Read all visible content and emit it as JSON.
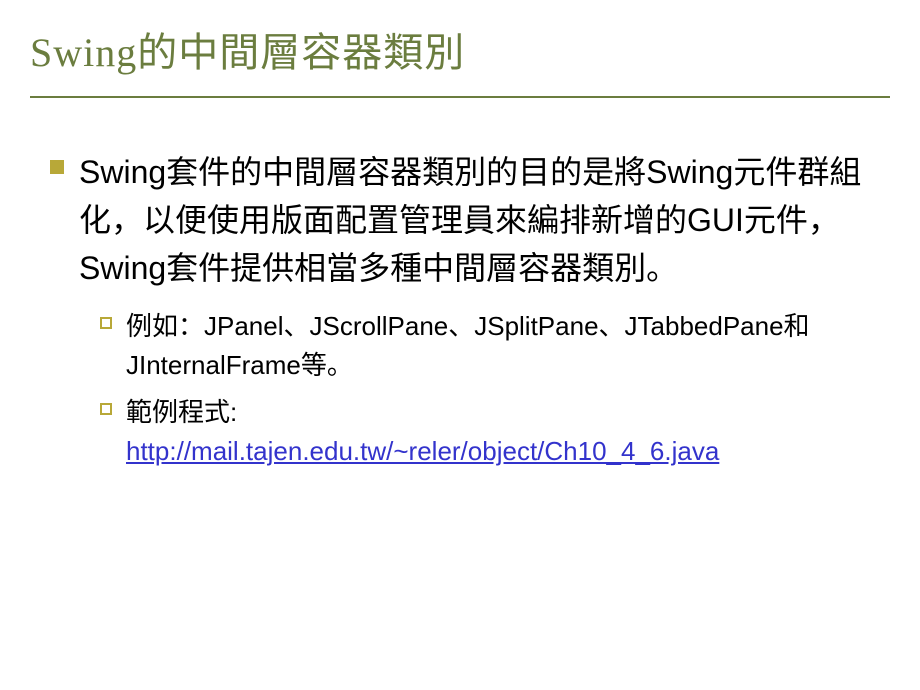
{
  "slide": {
    "title": "Swing的中間層容器類別",
    "main_bullet": "Swing套件的中間層容器類別的目的是將Swing元件群組化，以便使用版面配置管理員來編排新增的GUI元件，Swing套件提供相當多種中間層容器類別。",
    "sub_bullets": [
      {
        "text": "例如：JPanel、JScrollPane、JSplitPane、JTabbedPane和JInternalFrame等。",
        "has_link": false
      },
      {
        "text": "範例程式:",
        "has_link": true,
        "link_text": "http://mail.tajen.edu.tw/~reler/object/Ch10_4_6.java"
      }
    ]
  }
}
